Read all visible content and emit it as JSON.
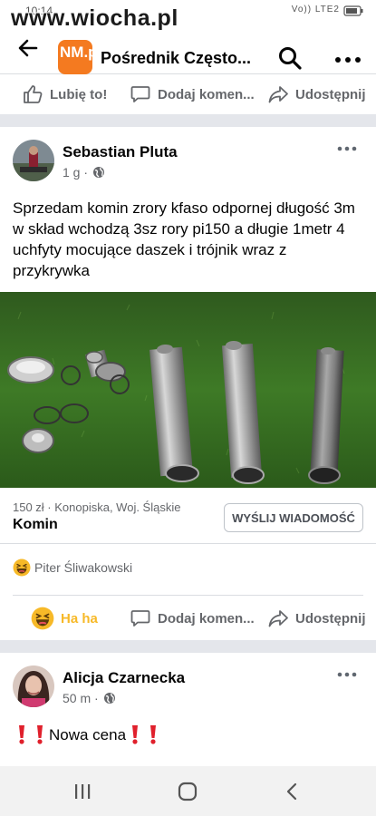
{
  "status_bar": {
    "time": "10:14",
    "network": "Vo)) LTE2"
  },
  "watermark": "www.wiocha.pl",
  "appbar": {
    "logo_text": "NM.pl",
    "title": "Pośrednik Często..."
  },
  "top_actions": {
    "like": "Lubię to!",
    "comment": "Dodaj komen...",
    "share": "Udostępnij"
  },
  "post1": {
    "author": "Sebastian Pluta",
    "time": "1 g ·",
    "text": "Sprzedam komin zrory kfaso odpornej długość 3m w skład wchodzą 3sz rory pi150 a długie 1metr 4 uchfyty mocujące daszek i trójnik wraz z przykrywka",
    "listing": {
      "price_location": "150 zł · Konopiska, Woj. Śląskie",
      "title": "Komin",
      "button": "WYŚLIJ WIADOMOŚĆ"
    },
    "reactions": {
      "names": "Piter Śliwakowski"
    },
    "actions": {
      "haha": "Ha ha",
      "comment": "Dodaj komen...",
      "share": "Udostępnij"
    }
  },
  "post2": {
    "author": "Alicja Czarnecka",
    "time": "50 m ·",
    "text": "Nowa cena"
  },
  "colors": {
    "facebook_blue": "#1877f2",
    "brand_orange": "#f47a20",
    "haha_yellow": "#f7b928",
    "text_secondary": "#65676b"
  }
}
